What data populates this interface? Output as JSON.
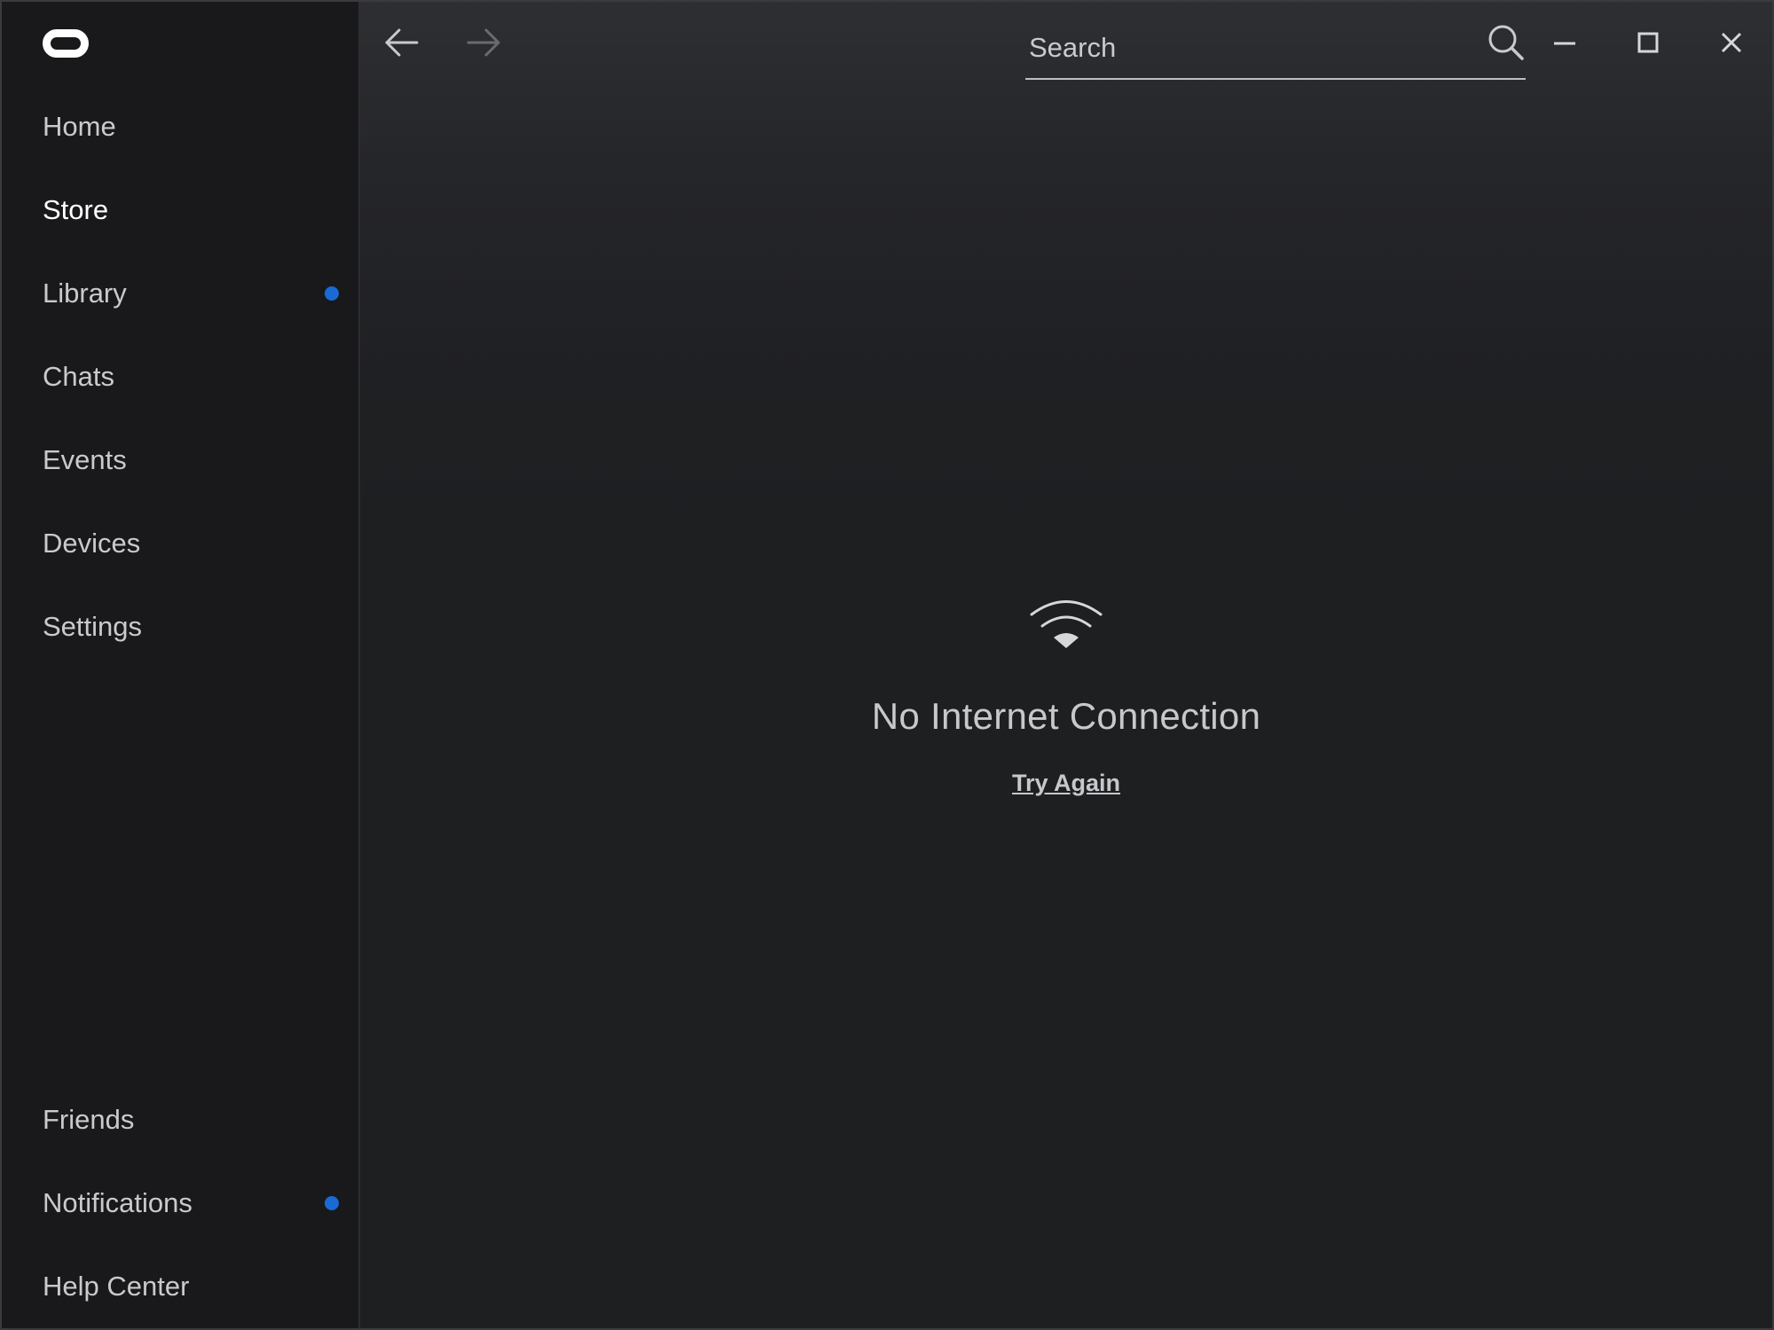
{
  "sidebar": {
    "logo_icon": "oculus-logo-icon",
    "items": [
      {
        "label": "Home",
        "active": false,
        "badge": false
      },
      {
        "label": "Store",
        "active": true,
        "badge": false
      },
      {
        "label": "Library",
        "active": false,
        "badge": true
      },
      {
        "label": "Chats",
        "active": false,
        "badge": false
      },
      {
        "label": "Events",
        "active": false,
        "badge": false
      },
      {
        "label": "Devices",
        "active": false,
        "badge": false
      },
      {
        "label": "Settings",
        "active": false,
        "badge": false
      }
    ],
    "bottom_items": [
      {
        "label": "Friends",
        "badge": false
      },
      {
        "label": "Notifications",
        "badge": true
      },
      {
        "label": "Help Center",
        "badge": false
      }
    ],
    "badge_color": "#1a6ad6"
  },
  "toolbar": {
    "back_icon": "arrow-left-icon",
    "forward_icon": "arrow-right-icon",
    "search": {
      "placeholder": "Search",
      "value": ""
    },
    "window_controls": [
      "minimize-icon",
      "maximize-icon",
      "close-icon"
    ]
  },
  "content": {
    "status_icon": "wifi-icon",
    "message": "No Internet Connection",
    "retry_label": "Try Again"
  }
}
